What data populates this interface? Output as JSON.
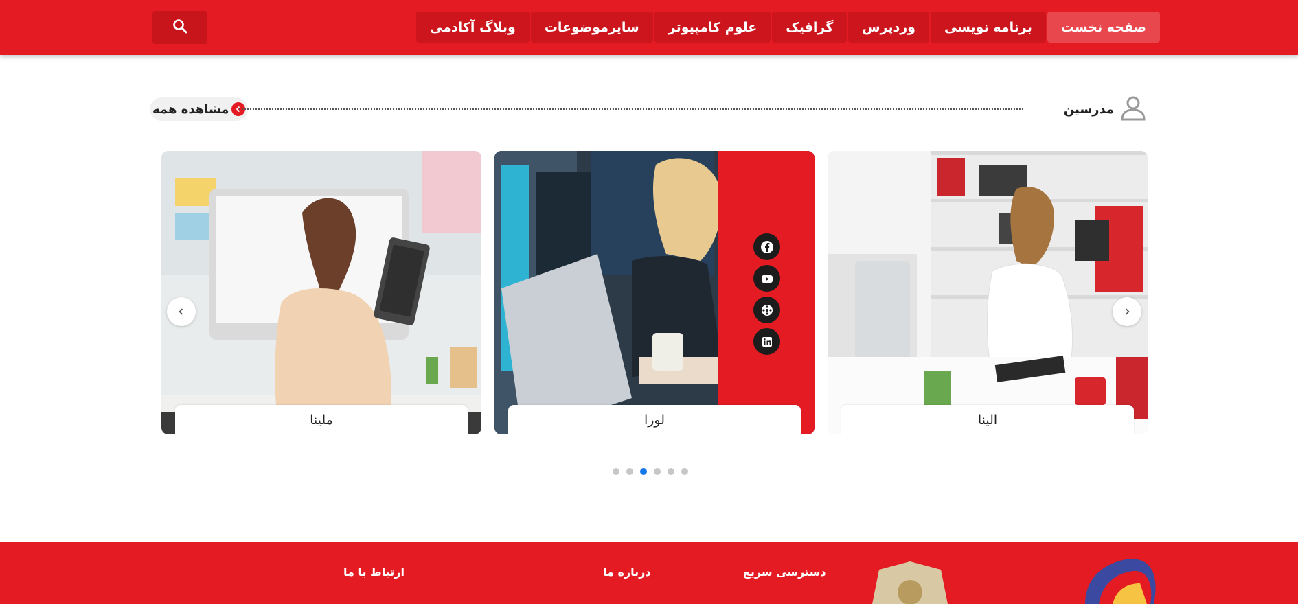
{
  "nav": {
    "items": [
      {
        "label": "صفحه نخست",
        "active": true
      },
      {
        "label": "برنامه نویسی",
        "active": false
      },
      {
        "label": "وردپرس",
        "active": false
      },
      {
        "label": "گرافیک",
        "active": false
      },
      {
        "label": "علوم کامپیوتر",
        "active": false
      },
      {
        "label": "سایرموضوعات",
        "active": false
      },
      {
        "label": "وبلاگ آکادمی",
        "active": false
      }
    ],
    "search_icon": "search-icon"
  },
  "section": {
    "title": "مدرسین",
    "title_icon": "user-icon",
    "view_all_label": "مشاهده همه"
  },
  "cards": [
    {
      "name": "الینا"
    },
    {
      "name": "لورا",
      "social": [
        "facebook-icon",
        "youtube-icon",
        "dribbble-icon",
        "linkedin-icon"
      ]
    },
    {
      "name": "ملینا"
    }
  ],
  "slider": {
    "dots_count": 6,
    "active_dot": 2
  },
  "footer": {
    "quick_access": "دسترسی سریع",
    "about": "درباره ما",
    "contact": "ارتباط با ما"
  },
  "colors": {
    "brand_red": "#e41b23",
    "dot_active": "#1677e9"
  }
}
